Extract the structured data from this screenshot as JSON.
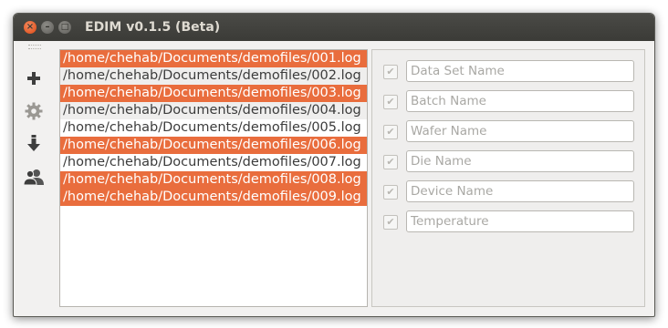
{
  "window": {
    "title": "EDIM v0.1.5 (Beta)",
    "controls": {
      "close": "×",
      "minimize": "–",
      "maximize": "□"
    }
  },
  "toolbar": {
    "items": [
      {
        "icon": "plus-icon"
      },
      {
        "icon": "gear-icon"
      },
      {
        "icon": "download-icon"
      },
      {
        "icon": "users-icon"
      }
    ]
  },
  "files": [
    {
      "path": "/home/chehab/Documents/demofiles/001.log",
      "selected": true
    },
    {
      "path": "/home/chehab/Documents/demofiles/002.log",
      "selected": false
    },
    {
      "path": "/home/chehab/Documents/demofiles/003.log",
      "selected": true
    },
    {
      "path": "/home/chehab/Documents/demofiles/004.log",
      "selected": false
    },
    {
      "path": "/home/chehab/Documents/demofiles/005.log",
      "selected": false
    },
    {
      "path": "/home/chehab/Documents/demofiles/006.log",
      "selected": true
    },
    {
      "path": "/home/chehab/Documents/demofiles/007.log",
      "selected": false
    },
    {
      "path": "/home/chehab/Documents/demofiles/008.log",
      "selected": true
    },
    {
      "path": "/home/chehab/Documents/demofiles/009.log",
      "selected": true
    }
  ],
  "fields": [
    {
      "placeholder": "Data Set Name",
      "checked": true
    },
    {
      "placeholder": "Batch Name",
      "checked": true
    },
    {
      "placeholder": "Wafer Name",
      "checked": true
    },
    {
      "placeholder": "Die Name",
      "checked": true
    },
    {
      "placeholder": "Device Name",
      "checked": true
    },
    {
      "placeholder": "Temperature",
      "checked": true
    }
  ],
  "colors": {
    "selection": "#e96d3d",
    "titlebar": "#3c3b37",
    "close_button": "#dd4814"
  }
}
